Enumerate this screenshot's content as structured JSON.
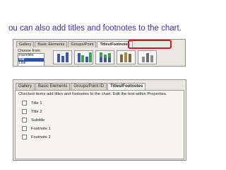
{
  "caption": {
    "text": "ou can also add titles and footnotes to the chart."
  },
  "panel_top": {
    "tabs": [
      {
        "label": "Gallery"
      },
      {
        "label": "Basic Elements"
      },
      {
        "label": "Groups/Point"
      },
      {
        "label": "Titles/Footnotes"
      }
    ],
    "highlighted_tab": "Titles/Footnotes",
    "choose_from_label": "Choose from:",
    "choose_from_items": [
      {
        "label": "Favorites"
      },
      {
        "label": "Bar"
      },
      {
        "label": "Line"
      }
    ],
    "selected_item": "Bar",
    "colors": {
      "highlight": "#d3182c",
      "selection": "#2b53a6"
    }
  },
  "panel_bottom": {
    "tabs": [
      {
        "label": "Gallery"
      },
      {
        "label": "Basic Elements"
      },
      {
        "label": "Groups/Point ID"
      },
      {
        "label": "Titles/Footnotes"
      }
    ],
    "active_tab": "Titles/Footnotes",
    "instructions": "Checked items add titles and footnotes to the chart. Edit the text within Properties.",
    "checkboxes": [
      {
        "label": "Title 1",
        "checked": false
      },
      {
        "label": "Title 2",
        "checked": false
      },
      {
        "label": "Subtitle",
        "checked": false
      },
      {
        "label": "Footnote 1",
        "checked": false
      },
      {
        "label": "Footnote 2",
        "checked": false
      }
    ]
  }
}
